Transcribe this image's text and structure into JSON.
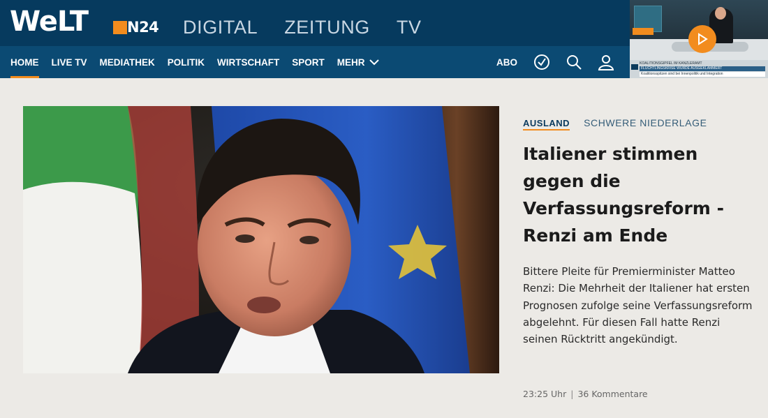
{
  "header": {
    "brand": "WeLT",
    "brand_sub": "N24",
    "sections": [
      "DIGITAL",
      "ZEITUNG",
      "TV"
    ],
    "nav": [
      {
        "label": "HOME",
        "active": true
      },
      {
        "label": "LIVE TV",
        "active": false
      },
      {
        "label": "MEDIATHEK",
        "active": false
      },
      {
        "label": "POLITIK",
        "active": false
      },
      {
        "label": "WIRTSCHAFT",
        "active": false
      },
      {
        "label": "SPORT",
        "active": false
      },
      {
        "label": "MEHR",
        "active": false
      }
    ],
    "abo": "ABO",
    "icons": [
      "clock-icon",
      "search-icon",
      "user-icon"
    ],
    "accent": "#f28c1e",
    "background": "#063a5e"
  },
  "video": {
    "ticker_top": "KOALITIONSGIPFEL IM KANZLERAMT",
    "ticker_headline": "FLÜCHTLINGSKRISE WURDE AUSGEKLAMMERT",
    "ticker_sub": "Koalitionsspitzen sind bei Innenpolitik und Integration"
  },
  "article": {
    "category": "AUSLAND",
    "topic": "SCHWERE NIEDERLAGE",
    "headline": "Italiener stimmen gegen die Verfassungsreform - Renzi am Ende",
    "teaser": "Bittere Pleite für Premierminister Matteo Renzi: Die Mehrheit der Italiener hat ersten Prognosen zufolge seine Verfassungsreform abgelehnt. Für diesen Fall hatte Renzi seinen Rücktritt angekündigt.",
    "time": "23:25 Uhr",
    "separator": "|",
    "comments": "36 Kommentare"
  }
}
